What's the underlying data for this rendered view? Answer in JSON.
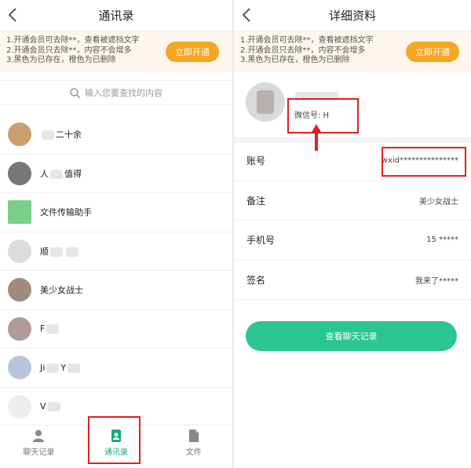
{
  "left": {
    "title": "通讯录",
    "banner": {
      "lines": [
        "1.开通会员可去除**，查看被遮挡文字",
        "2.开通会员只去除**，内容不会增多",
        "3.黑色为已存在，橙色为已删除"
      ],
      "vip_label": "立即开通"
    },
    "search": {
      "placeholder": "输入您要查找的内容"
    },
    "contacts": [
      {
        "name_pre": "",
        "name_post": "二十余",
        "avatar_color": "#c8a070"
      },
      {
        "name_pre": "人",
        "name_post": "值得",
        "avatar_color": "#777777"
      },
      {
        "name_pre": "",
        "name_post": "文件传输助手",
        "avatar_color": "#7ccf8a"
      },
      {
        "name_pre": "顺",
        "name_post": "",
        "avatar_color": "#dcdcdc"
      },
      {
        "name_pre": "",
        "name_post": "美少女战士",
        "avatar_color": "#9e8a7e"
      },
      {
        "name_pre": "F",
        "name_post": "",
        "avatar_color": "#b09a9a"
      },
      {
        "name_pre": "Ji",
        "name_post": "Y",
        "avatar_color": "#b8c4d8"
      },
      {
        "name_pre": "V",
        "name_post": "",
        "avatar_color": "#eeeeee"
      }
    ],
    "tabs": [
      {
        "label": "聊天记录",
        "icon": "person-icon"
      },
      {
        "label": "通讯录",
        "icon": "contacts-book-icon"
      },
      {
        "label": "文件",
        "icon": "file-icon"
      }
    ],
    "active_tab": 1
  },
  "right": {
    "title": "详细资料",
    "banner": {
      "lines": [
        "1.开通会员可去除**，查看被遮挡文字",
        "2.开通会员只去除**，内容不会增多",
        "3.黑色为已存在，橙色为已删除"
      ],
      "vip_label": "立即开通"
    },
    "profile": {
      "nickname": "",
      "wechat_id": "微信号: H"
    },
    "fields": [
      {
        "key": "账号",
        "value": "wxid***************"
      },
      {
        "key": "备注",
        "value": "美少女战士"
      },
      {
        "key": "手机号",
        "value": "15      *****"
      },
      {
        "key": "签名",
        "value": "我来了*****"
      }
    ],
    "chat_button": "查看聊天记录"
  },
  "colors": {
    "accent_green": "#2bc58f",
    "vip_orange": "#f5a623",
    "highlight_red": "#e02020"
  }
}
